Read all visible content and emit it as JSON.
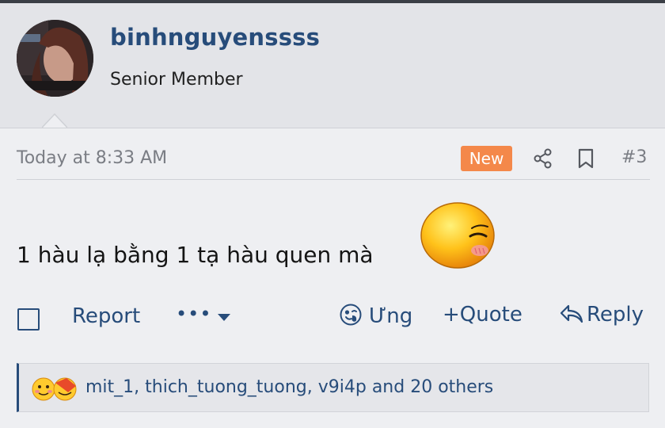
{
  "user": {
    "username": "binhnguyenssss",
    "title": "Senior Member",
    "avatar_icon": "user-avatar-photo"
  },
  "post": {
    "date": "Today at 8:33 AM",
    "new_badge": "New",
    "number": "#3",
    "body": "1 hàu lạ bằng 1 tạ hàu quen mà",
    "emoji_icon": "blushing-smiley-icon"
  },
  "actions": {
    "report": "Report",
    "more": "•••",
    "react": "Ưng",
    "quote": "+Quote",
    "reply": "Reply"
  },
  "reactions": {
    "text": "mit_1, thich_tuong_tuong, v9i4p and 20 others"
  },
  "colors": {
    "link": "#274c7a",
    "badge": "#f4884a",
    "background": "#eeeff2",
    "header": "#e3e4e8"
  }
}
